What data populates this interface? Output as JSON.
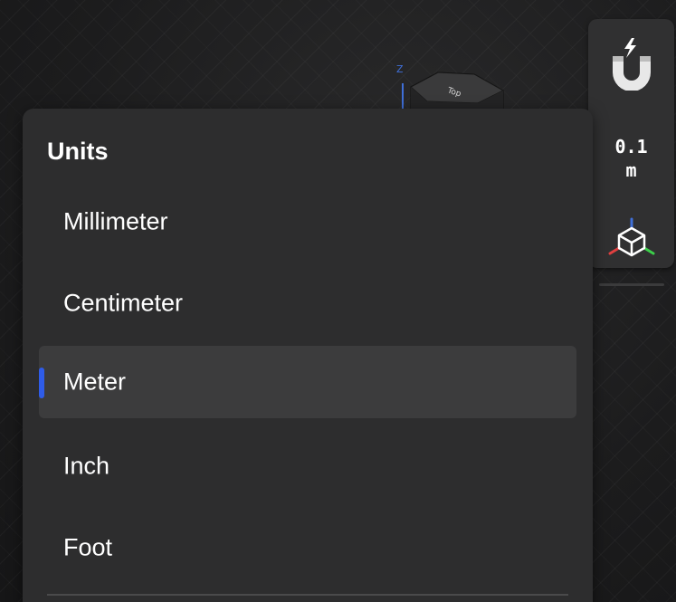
{
  "viewport": {
    "cube_face_label": "Top",
    "axis_z_label": "Z"
  },
  "tool_panel": {
    "snap_icon": "magnet-icon",
    "snap_value": "0.1",
    "snap_unit": "m",
    "axes_icon": "axes-cube-icon"
  },
  "units_menu": {
    "title": "Units",
    "items": [
      {
        "label": "Millimeter",
        "selected": false
      },
      {
        "label": "Centimeter",
        "selected": false
      },
      {
        "label": "Meter",
        "selected": true
      },
      {
        "label": "Inch",
        "selected": false
      },
      {
        "label": "Foot",
        "selected": false
      }
    ]
  },
  "colors": {
    "accent": "#2f5ce8",
    "menu_bg": "#2d2d2e",
    "selected_bg": "#3c3c3d",
    "axis_x": "#e04040",
    "axis_y": "#3ccf4a",
    "axis_z": "#3f6fd8"
  }
}
